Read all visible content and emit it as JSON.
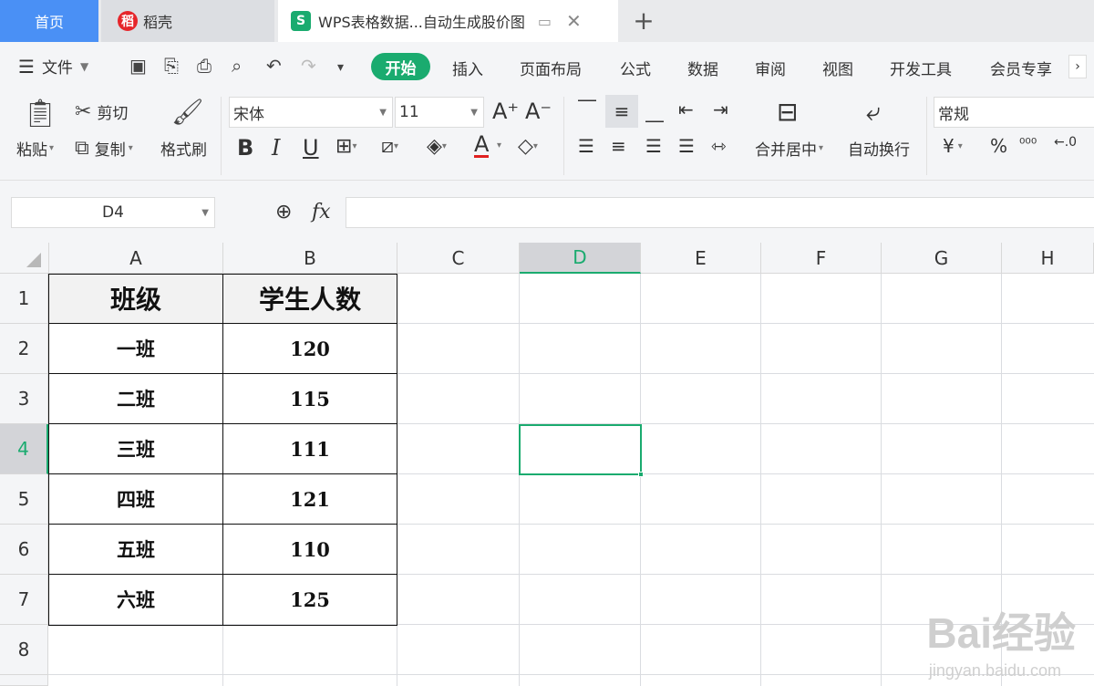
{
  "tabs": {
    "home": "首页",
    "daoke": "稻壳",
    "wps_title": "WPS表格数据...自动生成股价图",
    "new_tab": "+"
  },
  "menu": {
    "file": "文件",
    "items": [
      "开始",
      "插入",
      "页面布局",
      "公式",
      "数据",
      "审阅",
      "视图",
      "开发工具",
      "会员专享"
    ]
  },
  "ribbon": {
    "paste": "粘贴",
    "cut": "剪切",
    "copy": "复制",
    "format_painter": "格式刷",
    "font_name": "宋体",
    "font_size": "11",
    "merge_center": "合并居中",
    "wrap_text": "自动换行",
    "number_format": "常规"
  },
  "formula_bar": {
    "name_box": "D4",
    "fx": "fx",
    "value": ""
  },
  "grid": {
    "columns": [
      "A",
      "B",
      "C",
      "D",
      "E",
      "F",
      "G",
      "H"
    ],
    "rows": [
      "1",
      "2",
      "3",
      "4",
      "5",
      "6",
      "7",
      "8"
    ],
    "header": [
      "班级",
      "学生人数"
    ],
    "data": [
      [
        "一班",
        "120"
      ],
      [
        "二班",
        "115"
      ],
      [
        "三班",
        "111"
      ],
      [
        "四班",
        "121"
      ],
      [
        "五班",
        "110"
      ],
      [
        "六班",
        "125"
      ]
    ],
    "selected_cell": "D4"
  },
  "watermark": {
    "brand": "Bai经验",
    "url": "jingyan.baidu.com"
  },
  "colors": {
    "accent": "#1aab6f",
    "home_tab": "#4a90f5",
    "selected_header": "#d3d4d8"
  }
}
